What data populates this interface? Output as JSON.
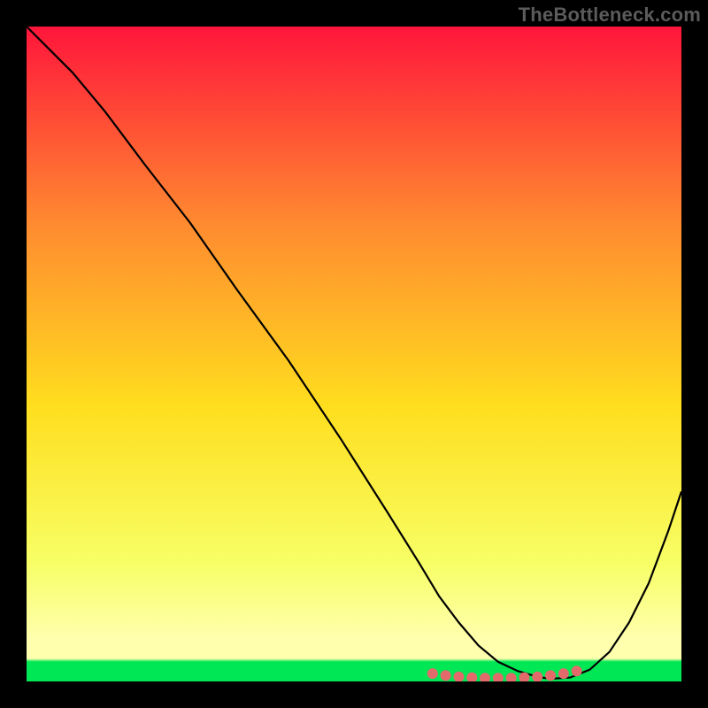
{
  "watermark": "TheBottleneck.com",
  "colors": {
    "bg": "#000000",
    "grad_top": "#ff153b",
    "grad_upper_mid": "#ff8a30",
    "grad_mid": "#ffde1e",
    "grad_lower": "#f7ff66",
    "grad_bottom_band": "#ffffad",
    "grad_green": "#00e756",
    "curve": "#000000",
    "marker": "#e36a6a"
  },
  "chart_data": {
    "type": "line",
    "title": "",
    "xlabel": "",
    "ylabel": "",
    "xlim": [
      0,
      100
    ],
    "ylim": [
      0,
      100
    ],
    "series": [
      {
        "name": "curve",
        "x": [
          0,
          3,
          7,
          12,
          18,
          25,
          32,
          40,
          48,
          55,
          60,
          63,
          66,
          69,
          72,
          75,
          78,
          80,
          83,
          86,
          89,
          92,
          95,
          98,
          100
        ],
        "y": [
          100,
          97,
          93,
          87,
          79,
          70,
          60,
          49,
          37,
          26,
          18,
          13,
          9,
          5.5,
          3,
          1.6,
          0.7,
          0.4,
          0.6,
          1.8,
          4.5,
          9,
          15,
          23,
          29
        ]
      },
      {
        "name": "markers",
        "x": [
          62,
          64,
          66,
          68,
          70,
          72,
          74,
          76,
          78,
          80,
          82,
          84
        ],
        "y": [
          1.2,
          0.9,
          0.7,
          0.6,
          0.5,
          0.5,
          0.5,
          0.6,
          0.7,
          0.9,
          1.2,
          1.6
        ]
      }
    ]
  }
}
